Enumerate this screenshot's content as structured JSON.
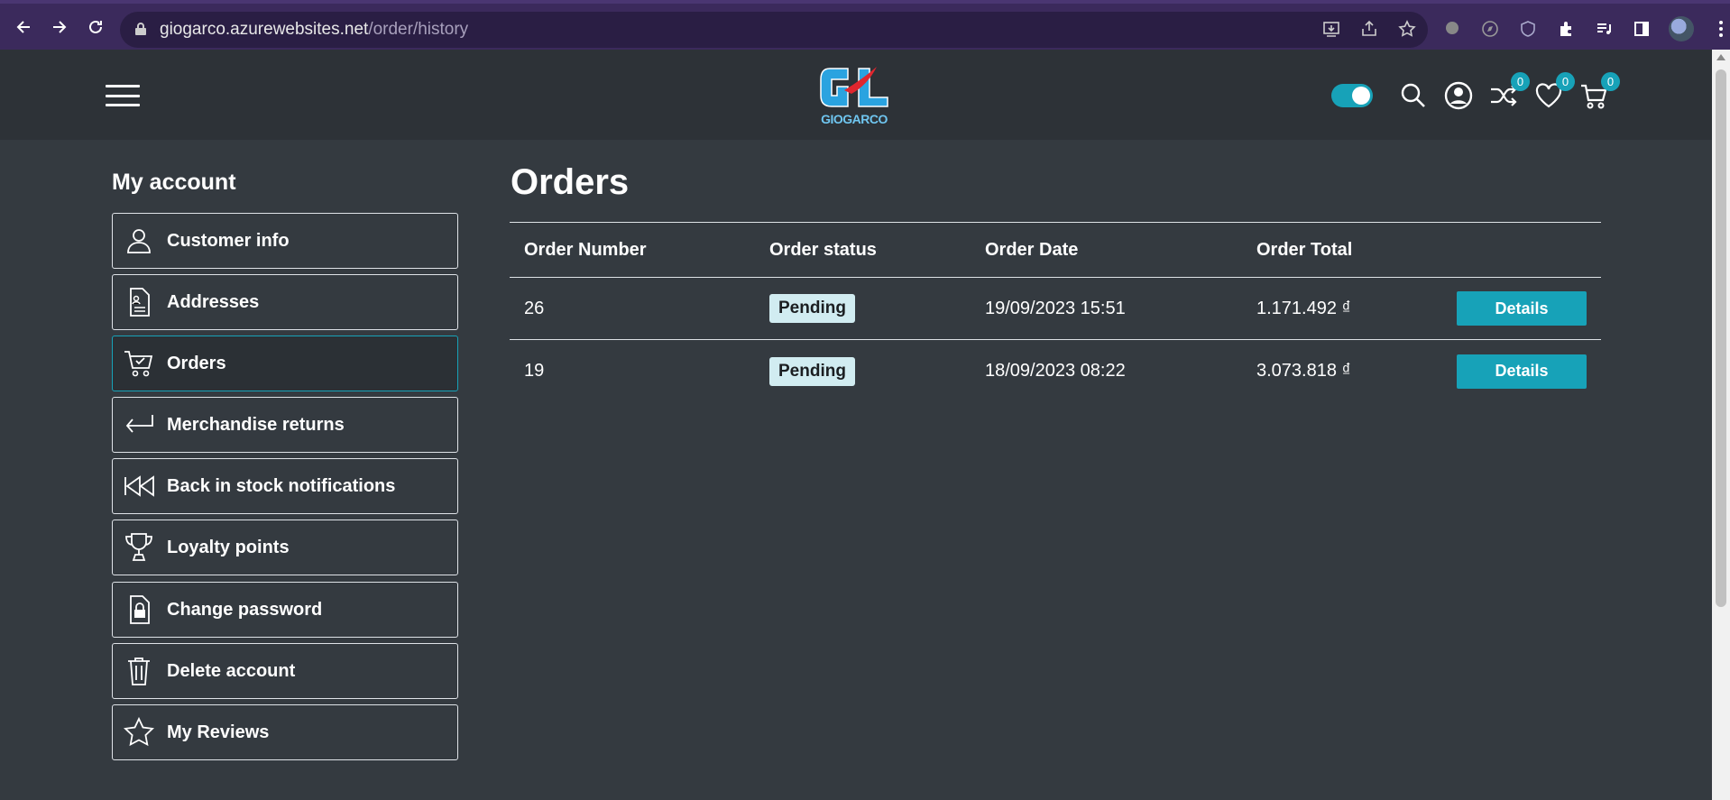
{
  "browser": {
    "url_host": "giogarco.azurewebsites.net",
    "url_path": "/order/history"
  },
  "header": {
    "logo_text": "GIOGARCO",
    "compare_count": "0",
    "wishlist_count": "0",
    "cart_count": "0",
    "accent_color": "#17a2b8"
  },
  "sidebar": {
    "title": "My account",
    "items": [
      {
        "label": "Customer info",
        "icon": "user-icon"
      },
      {
        "label": "Addresses",
        "icon": "address-document-icon"
      },
      {
        "label": "Orders",
        "icon": "cart-check-icon",
        "active": true
      },
      {
        "label": "Merchandise returns",
        "icon": "return-arrow-icon"
      },
      {
        "label": "Back in stock notifications",
        "icon": "rewind-icon"
      },
      {
        "label": "Loyalty points",
        "icon": "trophy-icon"
      },
      {
        "label": "Change password",
        "icon": "lock-document-icon"
      },
      {
        "label": "Delete account",
        "icon": "trash-icon"
      },
      {
        "label": "My Reviews",
        "icon": "star-icon"
      }
    ]
  },
  "main": {
    "title": "Orders",
    "columns": [
      "Order Number",
      "Order status",
      "Order Date",
      "Order Total"
    ],
    "orders": [
      {
        "number": "26",
        "status": "Pending",
        "date": "19/09/2023 15:51",
        "total": "1.171.492 ₫",
        "action": "Details"
      },
      {
        "number": "19",
        "status": "Pending",
        "date": "18/09/2023 08:22",
        "total": "3.073.818 ₫",
        "action": "Details"
      }
    ]
  }
}
